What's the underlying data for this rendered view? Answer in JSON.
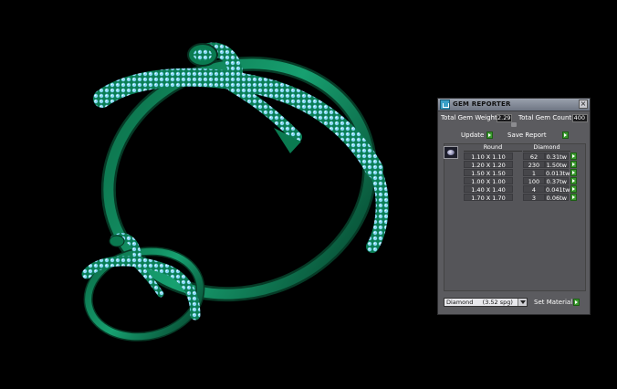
{
  "panel": {
    "title": "GEM REPORTER",
    "close_label": "×",
    "total_weight_label": "Total Gem Weight",
    "total_weight_value": "2.29",
    "total_count_label": "Total Gem Count",
    "total_count_value": "400",
    "update_label": "Update",
    "save_label": "Save Report",
    "col_shape": "Round",
    "col_material": "Diamond",
    "rows": [
      {
        "size": "1.10 X 1.10",
        "count": "62",
        "weight": "0.31tw"
      },
      {
        "size": "1.20 X 1.20",
        "count": "230",
        "weight": "1.50tw"
      },
      {
        "size": "1.50 X 1.50",
        "count": "1",
        "weight": "0.013tw"
      },
      {
        "size": "1.00 X 1.00",
        "count": "100",
        "weight": "0.37tw"
      },
      {
        "size": "1.40 X 1.40",
        "count": "4",
        "weight": "0.041tw"
      },
      {
        "size": "1.70 X 1.70",
        "count": "3",
        "weight": "0.06tw"
      }
    ],
    "material_select": "Diamond     (3.52 spg)",
    "set_material_label": "Set Material"
  },
  "colors": {
    "panel_bg": "#5b5b5f",
    "accent_green": "#3a9a2e",
    "metal_green": "#0f8a5a",
    "gem_blue": "#7fd3f0"
  }
}
